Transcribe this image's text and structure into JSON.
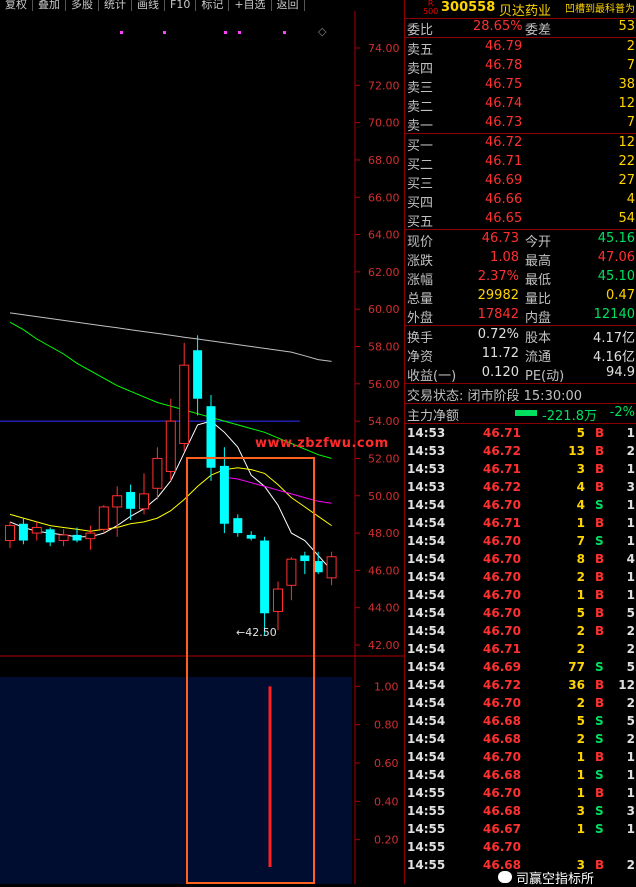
{
  "toolbar": {
    "buttons": [
      "复权",
      "叠加",
      "多股",
      "统计",
      "画线",
      "F10",
      "标记",
      "+自选",
      "返回"
    ]
  },
  "chart": {
    "y_axis_ticks": [
      "74.00",
      "72.00",
      "70.00",
      "68.00",
      "66.00",
      "64.00",
      "62.00",
      "60.00",
      "58.00",
      "56.00",
      "54.00",
      "52.00",
      "50.00",
      "48.00",
      "46.00",
      "44.00",
      "42.00"
    ],
    "sub_axis_ticks": [
      "1.00",
      "0.80",
      "0.60",
      "0.40",
      "0.20"
    ],
    "low_label": "42.50",
    "watermark": "www.zbzfwu.com",
    "colors": {
      "up": "#ff3030",
      "down": "#00ffff",
      "ma5": "#ffffff",
      "ma10": "#ffff00",
      "ma20": "#ff00ff",
      "ma30": "#00ff00",
      "ma60": "#c0c0c0",
      "ref": "#3030ff",
      "highlight": "#ff6020"
    }
  },
  "chart_data": {
    "type": "candlestick",
    "y_range": [
      42,
      74
    ],
    "candles": [
      {
        "o": 47.6,
        "h": 48.6,
        "l": 47.2,
        "c": 48.4
      },
      {
        "o": 48.5,
        "h": 48.8,
        "l": 47.4,
        "c": 47.6
      },
      {
        "o": 48.0,
        "h": 48.6,
        "l": 47.6,
        "c": 48.3
      },
      {
        "o": 48.2,
        "h": 48.3,
        "l": 47.3,
        "c": 47.5
      },
      {
        "o": 47.6,
        "h": 48.2,
        "l": 47.3,
        "c": 47.9
      },
      {
        "o": 47.9,
        "h": 48.3,
        "l": 47.5,
        "c": 47.6
      },
      {
        "o": 47.7,
        "h": 48.4,
        "l": 47.1,
        "c": 48.0
      },
      {
        "o": 48.2,
        "h": 49.5,
        "l": 48.0,
        "c": 49.4
      },
      {
        "o": 49.4,
        "h": 50.5,
        "l": 47.8,
        "c": 50.0
      },
      {
        "o": 50.2,
        "h": 50.6,
        "l": 48.7,
        "c": 49.3
      },
      {
        "o": 49.3,
        "h": 51.2,
        "l": 49.0,
        "c": 50.1
      },
      {
        "o": 50.4,
        "h": 52.6,
        "l": 49.8,
        "c": 52.0
      },
      {
        "o": 51.3,
        "h": 55.2,
        "l": 50.8,
        "c": 54.0
      },
      {
        "o": 52.8,
        "h": 58.2,
        "l": 52.4,
        "c": 57.0
      },
      {
        "o": 57.8,
        "h": 58.6,
        "l": 54.3,
        "c": 55.2
      },
      {
        "o": 54.8,
        "h": 55.4,
        "l": 50.8,
        "c": 51.5
      },
      {
        "o": 51.6,
        "h": 52.6,
        "l": 48.0,
        "c": 48.5
      },
      {
        "o": 48.8,
        "h": 49.0,
        "l": 47.8,
        "c": 48.0
      },
      {
        "o": 47.9,
        "h": 48.1,
        "l": 47.6,
        "c": 47.7
      },
      {
        "o": 47.6,
        "h": 47.8,
        "l": 42.5,
        "c": 43.7
      },
      {
        "o": 43.8,
        "h": 45.4,
        "l": 42.8,
        "c": 45.0
      },
      {
        "o": 45.2,
        "h": 46.7,
        "l": 44.4,
        "c": 46.6
      },
      {
        "o": 46.8,
        "h": 47.0,
        "l": 45.8,
        "c": 46.5
      },
      {
        "o": 46.5,
        "h": 47.0,
        "l": 45.8,
        "c": 45.9
      },
      {
        "o": 45.6,
        "h": 47.0,
        "l": 45.2,
        "c": 46.73
      }
    ],
    "ma_lines": [
      {
        "name": "ma5",
        "values": [
          48.6,
          48.3,
          48.1,
          48.0,
          47.9,
          47.8,
          47.8,
          48.0,
          48.4,
          48.9,
          49.3,
          49.9,
          50.8,
          52.3,
          53.8,
          54.0,
          53.4,
          52.6,
          51.1,
          50.5,
          49.5,
          48.0,
          47.6,
          46.8,
          46.0
        ]
      },
      {
        "name": "ma10",
        "values": [
          49.0,
          48.8,
          48.6,
          48.4,
          48.3,
          48.2,
          48.1,
          48.2,
          48.3,
          48.5,
          48.6,
          48.8,
          49.2,
          49.8,
          50.5,
          51.1,
          51.4,
          51.5,
          51.4,
          51.2,
          50.6,
          49.9,
          49.4,
          48.9,
          48.4
        ]
      },
      {
        "name": "ma20",
        "values": [
          null,
          null,
          null,
          null,
          null,
          null,
          null,
          null,
          null,
          null,
          null,
          null,
          null,
          null,
          null,
          null,
          51.0,
          50.9,
          50.7,
          50.5,
          50.3,
          50.1,
          49.9,
          49.7,
          49.6
        ]
      },
      {
        "name": "ma30",
        "values": [
          59.3,
          58.9,
          58.4,
          58.0,
          57.6,
          57.1,
          56.7,
          56.3,
          55.9,
          55.6,
          55.3,
          55.0,
          54.8,
          54.6,
          54.4,
          54.2,
          54.0,
          53.8,
          53.6,
          53.4,
          53.1,
          52.8,
          52.5,
          52.2,
          52.0
        ]
      },
      {
        "name": "ma60",
        "values": [
          59.8,
          59.7,
          59.6,
          59.5,
          59.4,
          59.3,
          59.2,
          59.1,
          59.0,
          58.9,
          58.8,
          58.7,
          58.6,
          58.5,
          58.4,
          58.3,
          58.2,
          58.1,
          58.0,
          57.9,
          57.8,
          57.7,
          57.5,
          57.3,
          57.2
        ]
      }
    ],
    "ref_line": 54.0,
    "sub_chart": {
      "y_range": [
        0,
        1.0
      ],
      "bars": [
        {
          "index": 21,
          "value": 1.0
        }
      ]
    }
  },
  "quote": {
    "r_logo": "R\n500",
    "code": "300558",
    "name": "贝达药业",
    "hint": "凹槽到最科普为",
    "weibi": {
      "label": "委比",
      "pct": "28.65%",
      "label2": "委差",
      "val": "53"
    },
    "asks": [
      {
        "label": "卖五",
        "price": "46.79",
        "vol": "2"
      },
      {
        "label": "卖四",
        "price": "46.78",
        "vol": "7"
      },
      {
        "label": "卖三",
        "price": "46.75",
        "vol": "38"
      },
      {
        "label": "卖二",
        "price": "46.74",
        "vol": "12"
      },
      {
        "label": "卖一",
        "price": "46.73",
        "vol": "7"
      }
    ],
    "bids": [
      {
        "label": "买一",
        "price": "46.72",
        "vol": "12"
      },
      {
        "label": "买二",
        "price": "46.71",
        "vol": "22"
      },
      {
        "label": "买三",
        "price": "46.69",
        "vol": "27"
      },
      {
        "label": "买四",
        "price": "46.66",
        "vol": "4"
      },
      {
        "label": "买五",
        "price": "46.65",
        "vol": "54"
      }
    ],
    "stats": [
      {
        "l1": "现价",
        "v1": "46.73",
        "c1": "red",
        "l2": "今开",
        "v2": "45.16",
        "c2": "grn"
      },
      {
        "l1": "涨跌",
        "v1": "1.08",
        "c1": "red",
        "l2": "最高",
        "v2": "47.06",
        "c2": "red"
      },
      {
        "l1": "涨幅",
        "v1": "2.37%",
        "c1": "red",
        "l2": "最低",
        "v2": "45.10",
        "c2": "grn"
      },
      {
        "l1": "总量",
        "v1": "29982",
        "c1": "yel",
        "l2": "量比",
        "v2": "0.47",
        "c2": "yel"
      },
      {
        "l1": "外盘",
        "v1": "17842",
        "c1": "red",
        "l2": "内盘",
        "v2": "12140",
        "c2": "grn"
      }
    ],
    "stats2": [
      {
        "l1": "换手",
        "v1": "0.72%",
        "l2": "股本",
        "v2": "4.17亿"
      },
      {
        "l1": "净资",
        "v1": "11.72",
        "l2": "流通",
        "v2": "4.16亿"
      },
      {
        "l1": "收益(一)",
        "v1": "0.120",
        "l2": "PE(动)",
        "v2": "94.9"
      }
    ],
    "trade_status": "交易状态: 闭市阶段 15:30:00",
    "main_force": {
      "label": "主力净额",
      "value": "-221.8万",
      "pct": "-2%"
    }
  },
  "ticks": [
    {
      "t": "14:53",
      "p": "46.71",
      "v": "5",
      "d": "B",
      "n": "1"
    },
    {
      "t": "14:53",
      "p": "46.72",
      "v": "13",
      "d": "B",
      "n": "2"
    },
    {
      "t": "14:53",
      "p": "46.71",
      "v": "3",
      "d": "B",
      "n": "1"
    },
    {
      "t": "14:53",
      "p": "46.72",
      "v": "4",
      "d": "B",
      "n": "3"
    },
    {
      "t": "14:54",
      "p": "46.70",
      "v": "4",
      "d": "S",
      "n": "1"
    },
    {
      "t": "14:54",
      "p": "46.71",
      "v": "1",
      "d": "B",
      "n": "1"
    },
    {
      "t": "14:54",
      "p": "46.70",
      "v": "7",
      "d": "S",
      "n": "1"
    },
    {
      "t": "14:54",
      "p": "46.70",
      "v": "8",
      "d": "B",
      "n": "4"
    },
    {
      "t": "14:54",
      "p": "46.70",
      "v": "2",
      "d": "B",
      "n": "1"
    },
    {
      "t": "14:54",
      "p": "46.70",
      "v": "1",
      "d": "B",
      "n": "1"
    },
    {
      "t": "14:54",
      "p": "46.70",
      "v": "5",
      "d": "B",
      "n": "5"
    },
    {
      "t": "14:54",
      "p": "46.70",
      "v": "2",
      "d": "B",
      "n": "2"
    },
    {
      "t": "14:54",
      "p": "46.71",
      "v": "2",
      "d": "",
      "n": "2"
    },
    {
      "t": "14:54",
      "p": "46.69",
      "v": "77",
      "d": "S",
      "n": "5"
    },
    {
      "t": "14:54",
      "p": "46.72",
      "v": "36",
      "d": "B",
      "n": "12"
    },
    {
      "t": "14:54",
      "p": "46.70",
      "v": "2",
      "d": "B",
      "n": "2"
    },
    {
      "t": "14:54",
      "p": "46.68",
      "v": "5",
      "d": "S",
      "n": "5"
    },
    {
      "t": "14:54",
      "p": "46.68",
      "v": "2",
      "d": "S",
      "n": "2"
    },
    {
      "t": "14:54",
      "p": "46.70",
      "v": "1",
      "d": "B",
      "n": "1"
    },
    {
      "t": "14:54",
      "p": "46.68",
      "v": "1",
      "d": "S",
      "n": "1"
    },
    {
      "t": "14:55",
      "p": "46.70",
      "v": "1",
      "d": "B",
      "n": "1"
    },
    {
      "t": "14:55",
      "p": "46.68",
      "v": "3",
      "d": "S",
      "n": "3"
    },
    {
      "t": "14:55",
      "p": "46.67",
      "v": "1",
      "d": "S",
      "n": "1"
    },
    {
      "t": "14:55",
      "p": "46.70",
      "v": "",
      "d": "",
      "n": ""
    },
    {
      "t": "14:55",
      "p": "46.68",
      "v": "3",
      "d": "B",
      "n": "2"
    }
  ],
  "wechat": {
    "icon": "wechat-icon",
    "text": "司赢空指标所"
  }
}
